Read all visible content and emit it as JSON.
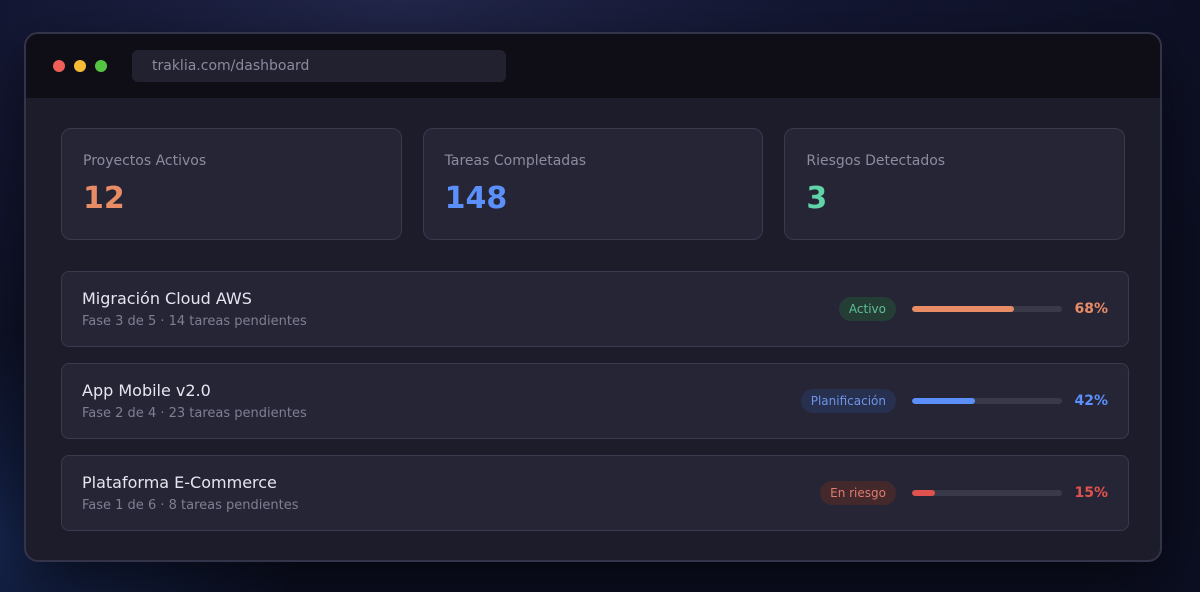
{
  "browser": {
    "url": "traklia.com/dashboard"
  },
  "colors": {
    "orange": "#e88c66",
    "blue": "#5b8ff9",
    "green": "#5fd4a6",
    "red": "#e0524e"
  },
  "stats": [
    {
      "label": "Proyectos Activos",
      "value": "12",
      "color": "#e88c66"
    },
    {
      "label": "Tareas Completadas",
      "value": "148",
      "color": "#5b8ff9"
    },
    {
      "label": "Riesgos Detectados",
      "value": "3",
      "color": "#5fd4a6"
    }
  ],
  "projects": [
    {
      "name": "Migración Cloud AWS",
      "subtitle": "Fase 3 de 5 · 14 tareas pendientes",
      "status": "Activo",
      "status_color": "#5fbf94",
      "status_bg": "#243d35",
      "progress": 68,
      "progress_label": "68%",
      "color": "#e88c66"
    },
    {
      "name": "App Mobile v2.0",
      "subtitle": "Fase 2 de 4 · 23 tareas pendientes",
      "status": "Planificación",
      "status_color": "#6f94e8",
      "status_bg": "#27304f",
      "progress": 42,
      "progress_label": "42%",
      "color": "#5b8ff9"
    },
    {
      "name": "Plataforma E-Commerce",
      "subtitle": "Fase 1 de 6 · 8 tareas pendientes",
      "status": "En riesgo",
      "status_color": "#e07a6e",
      "status_bg": "#43292c",
      "progress": 15,
      "progress_label": "15%",
      "color": "#e0524e"
    }
  ]
}
